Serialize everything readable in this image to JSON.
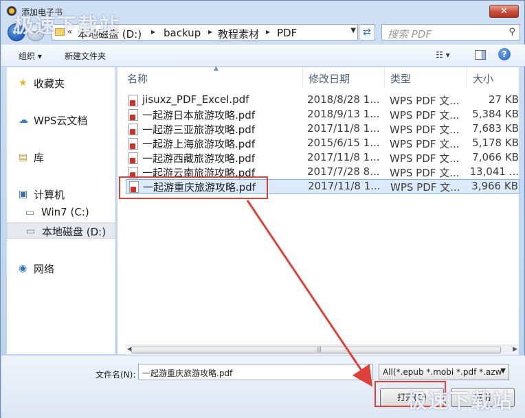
{
  "window": {
    "title": "添加电子书"
  },
  "address": {
    "prefix": "«",
    "segments": [
      "本地磁盘 (D:)",
      "backup",
      "教程素材",
      "PDF"
    ],
    "separator": "▸"
  },
  "search": {
    "placeholder": "搜索 PDF"
  },
  "toolbar": {
    "organize": "组织 ▾",
    "new_folder": "新建文件夹",
    "view": "☷ ▾"
  },
  "sidebar": {
    "items": [
      {
        "label": "收藏夹",
        "icon": "star-icon",
        "glyph": "★"
      },
      {
        "label": "WPS云文档",
        "icon": "cloud-icon",
        "glyph": "☁"
      },
      {
        "label": "库",
        "icon": "library-icon",
        "glyph": "▤"
      },
      {
        "label": "计算机",
        "icon": "computer-icon",
        "glyph": "▣"
      },
      {
        "label": "Win7 (C:)",
        "icon": "drive-icon",
        "glyph": "▭"
      },
      {
        "label": "本地磁盘 (D:)",
        "icon": "drive-icon",
        "glyph": "▭"
      },
      {
        "label": "网络",
        "icon": "network-icon",
        "glyph": "◉"
      }
    ]
  },
  "columns": {
    "name": "名称",
    "date": "修改日期",
    "type": "类型",
    "size": "大小"
  },
  "files": [
    {
      "name": "jisuxz_PDF_Excel.pdf",
      "date": "2018/8/28 1...",
      "type": "WPS PDF 文...",
      "size": "27 KB"
    },
    {
      "name": "一起游日本旅游攻略.pdf",
      "date": "2018/9/13 1...",
      "type": "WPS PDF 文...",
      "size": "5,384 KB"
    },
    {
      "name": "一起游三亚旅游攻略.pdf",
      "date": "2017/11/8 1...",
      "type": "WPS PDF 文...",
      "size": "7,683 KB"
    },
    {
      "name": "一起游上海旅游攻略.pdf",
      "date": "2015/6/15 1...",
      "type": "WPS PDF 文...",
      "size": "5,178 KB"
    },
    {
      "name": "一起游西藏旅游攻略.pdf",
      "date": "2017/11/8 1...",
      "type": "WPS PDF 文...",
      "size": "7,066 KB"
    },
    {
      "name": "一起游云南旅游攻略.pdf",
      "date": "2017/7/28 8...",
      "type": "WPS PDF 文...",
      "size": "13,041 ..."
    },
    {
      "name": "一起游重庆旅游攻略.pdf",
      "date": "2017/11/8 1...",
      "type": "WPS PDF 文...",
      "size": "3,966 KB",
      "selected": true
    }
  ],
  "bottom": {
    "filename_label": "文件名(N):",
    "filename_value": "一起游重庆旅游攻略.pdf",
    "filter_value": "All(*.epub *.mobi *.pdf *.azw",
    "open_label": "打开(O)",
    "cancel_label": "取消"
  },
  "watermark": {
    "text": "极速下载站"
  },
  "colors": {
    "highlight": "#e0403a",
    "selection": "#dcebfc"
  }
}
